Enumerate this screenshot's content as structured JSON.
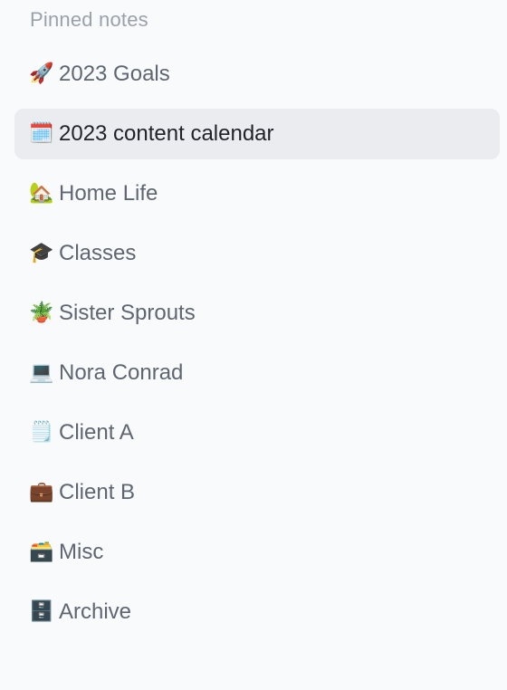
{
  "section": {
    "title": "Pinned notes"
  },
  "items": [
    {
      "emoji": "🚀",
      "label": "2023 Goals",
      "selected": false,
      "icon": "rocket-icon"
    },
    {
      "emoji": "🗓️",
      "label": "2023 content calendar",
      "selected": true,
      "icon": "calendar-icon"
    },
    {
      "emoji": "🏡",
      "label": "Home Life",
      "selected": false,
      "icon": "house-icon"
    },
    {
      "emoji": "🎓",
      "label": "Classes",
      "selected": false,
      "icon": "graduation-cap-icon"
    },
    {
      "emoji": "🪴",
      "label": "Sister Sprouts",
      "selected": false,
      "icon": "potted-plant-icon"
    },
    {
      "emoji": "💻",
      "label": "Nora Conrad",
      "selected": false,
      "icon": "laptop-icon"
    },
    {
      "emoji": "🗒️",
      "label": "Client A",
      "selected": false,
      "icon": "notepad-icon"
    },
    {
      "emoji": "💼",
      "label": "Client B",
      "selected": false,
      "icon": "briefcase-icon"
    },
    {
      "emoji": "🗃️",
      "label": "Misc",
      "selected": false,
      "icon": "card-file-box-icon"
    },
    {
      "emoji": "🗄️",
      "label": "Archive",
      "selected": false,
      "icon": "file-cabinet-icon"
    }
  ],
  "colors": {
    "background": "#f9fafc",
    "selected_background": "#ebecef",
    "text": "#5f6672",
    "selected_text": "#1f2329",
    "section_title": "#9aa1ab"
  }
}
